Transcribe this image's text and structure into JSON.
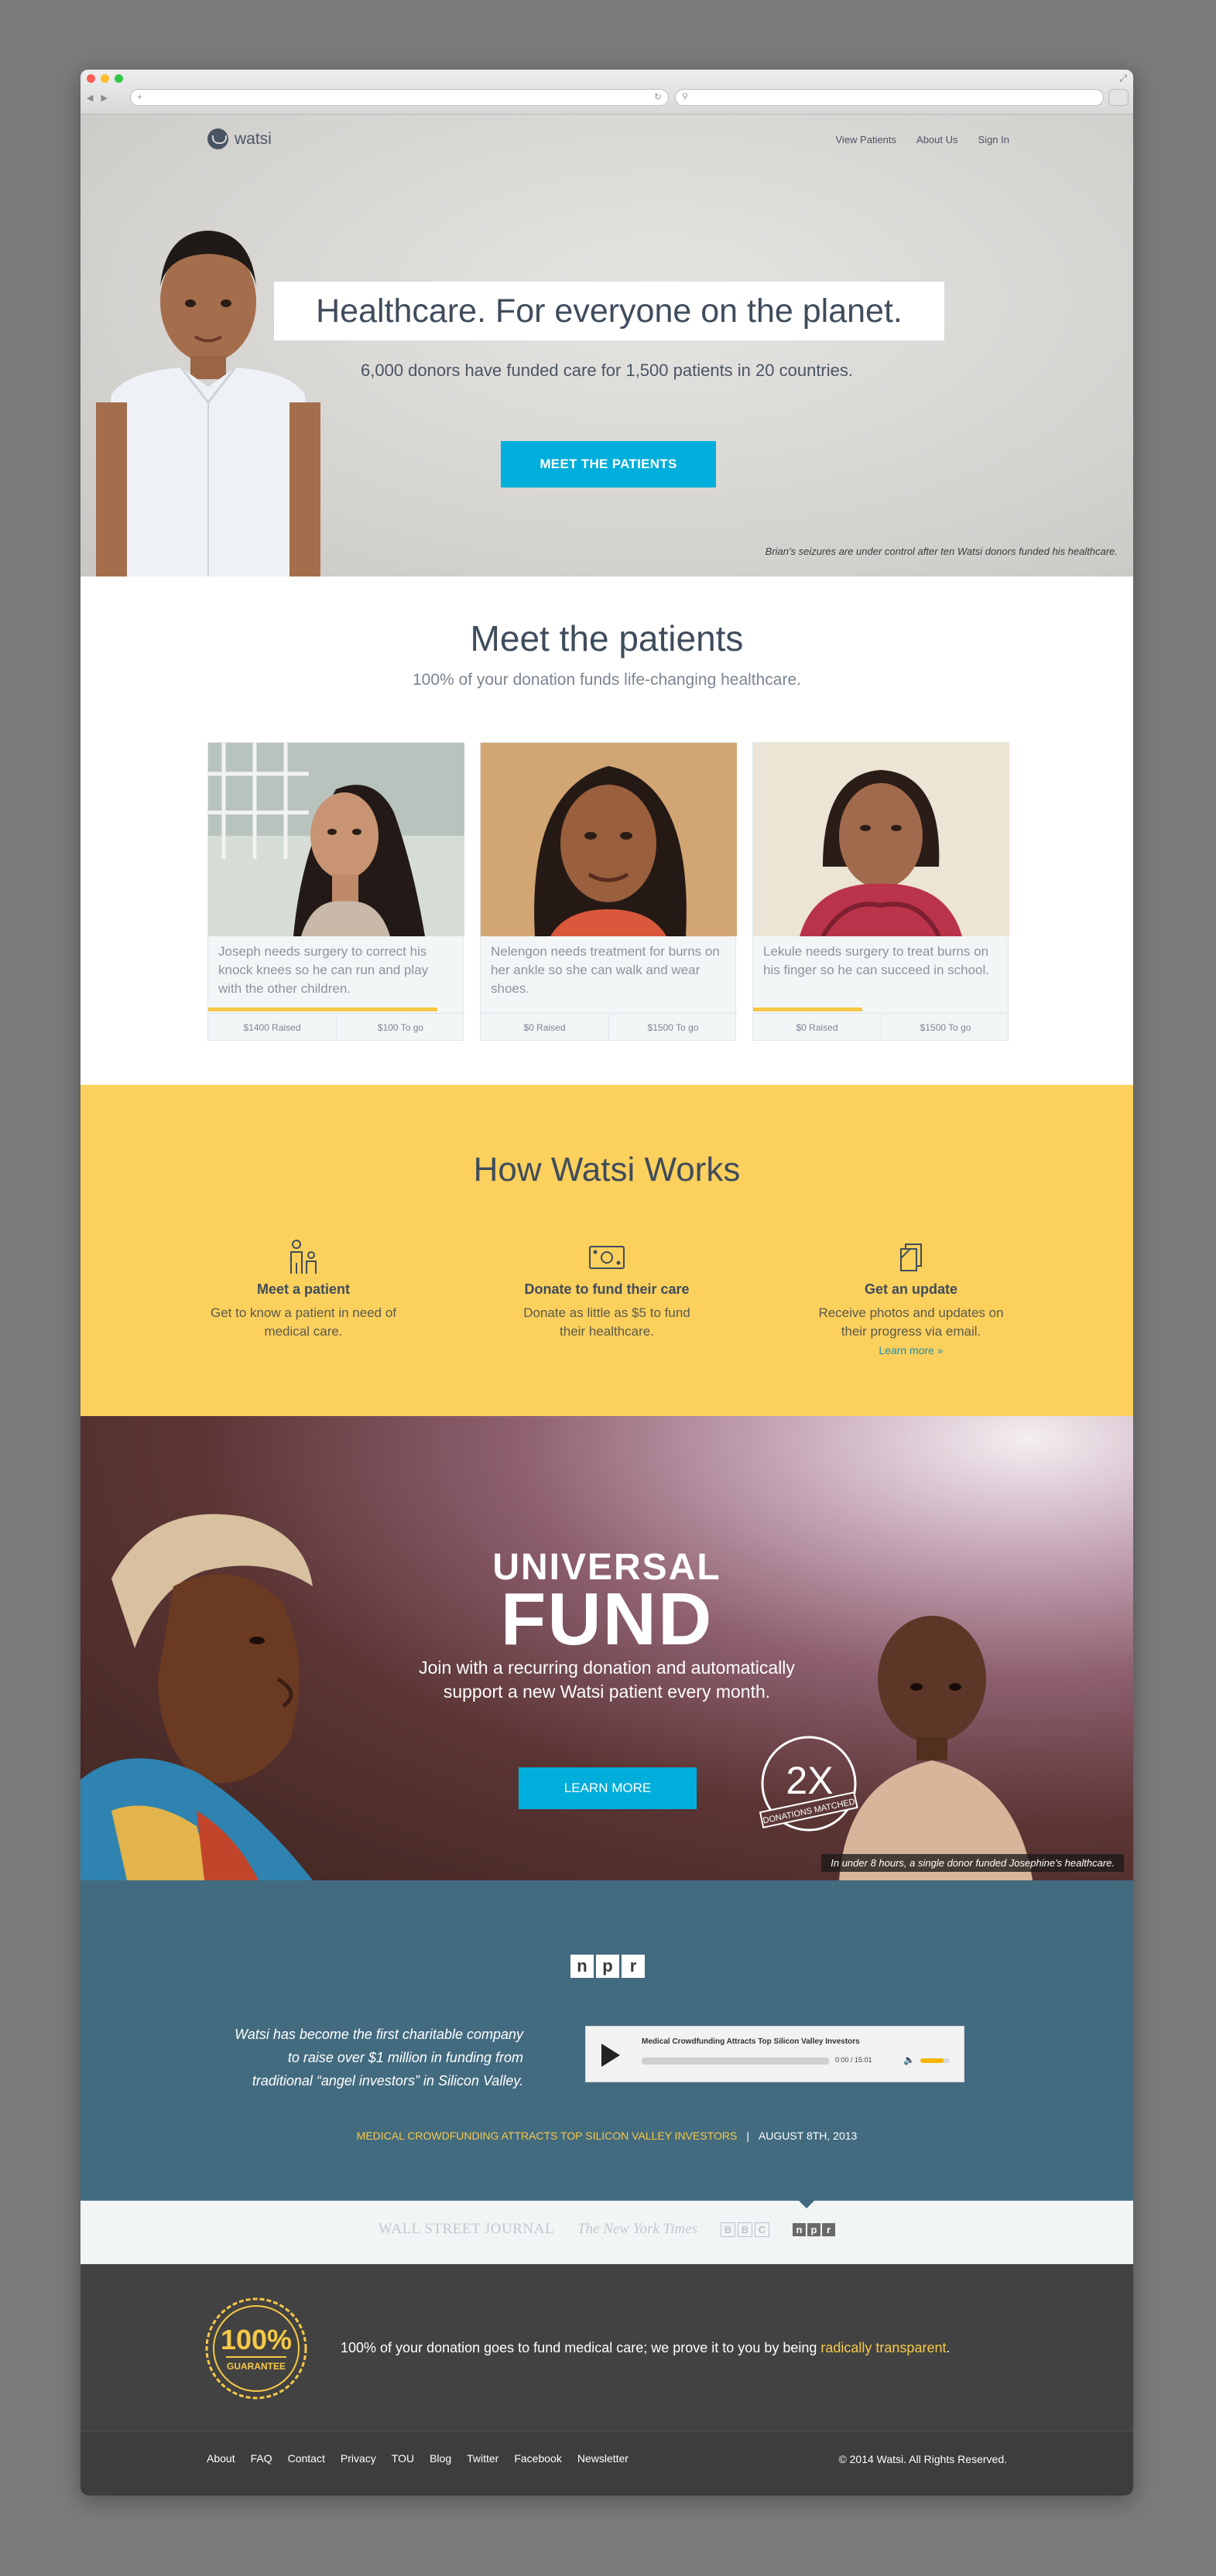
{
  "brand": {
    "logo_text": "watsi"
  },
  "nav": {
    "items": [
      "View Patients",
      "About Us",
      "Sign In"
    ]
  },
  "hero": {
    "title": "Healthcare. For everyone on the planet.",
    "subtitle": "6,000 donors have funded care for 1,500 patients in 20 countries.",
    "cta": "MEET THE PATIENTS",
    "caption": "Brian's seizures are under control after ten Watsi donors funded his healthcare."
  },
  "meet": {
    "title": "Meet the patients",
    "subtitle": "100% of your donation funds life-changing healthcare.",
    "patients": [
      {
        "description": "Joseph needs surgery to correct his knock knees so he can run and play with the other children.",
        "raised": "$1400 Raised",
        "to_go": "$100 To go",
        "progress": 0.9
      },
      {
        "description": "Nelengon needs treatment for burns on her ankle so she can walk and wear shoes.",
        "raised": "$0 Raised",
        "to_go": "$1500 To go",
        "progress": 0
      },
      {
        "description": "Lekule needs surgery to treat burns on his finger so he can succeed in school.",
        "raised": "$0 Raised",
        "to_go": "$1500 To go",
        "progress": 0.43
      }
    ]
  },
  "how": {
    "title": "How Watsi Works",
    "steps": [
      {
        "icon": "people-icon",
        "title": "Meet a patient",
        "text": "Get to know a patient in need of medical care."
      },
      {
        "icon": "money-icon",
        "title": "Donate to fund their care",
        "text": "Donate as little as $5 to fund their healthcare."
      },
      {
        "icon": "document-icon",
        "title": "Get an update",
        "text": "Receive photos and updates on their progress via email.",
        "link": "Learn more »"
      }
    ]
  },
  "fund": {
    "title_line1": "UNIVERSAL",
    "title_line2": "FUND",
    "subtitle": "Join with a recurring donation and automatically support a new Watsi patient every month.",
    "cta": "LEARN MORE",
    "badge_big": "2X",
    "badge_small": "DONATIONS MATCHED",
    "caption": "In under 8 hours, a single donor funded Josephine's healthcare."
  },
  "press": {
    "outlet_letters": [
      "n",
      "p",
      "r"
    ],
    "quote": "Watsi has become the first charitable company to raise over $1 million in funding from traditional “angel investors” in Silicon Valley.",
    "player": {
      "title": "Medical Crowdfunding Attracts Top Silicon Valley Investors",
      "time": "0:00 / 15:01",
      "volume": 0.8
    },
    "headline": "MEDICAL CROWDFUNDING ATTRACTS TOP SILICON VALLEY INVESTORS",
    "date": "AUGUST 8TH, 2013",
    "separator": "|"
  },
  "logos": {
    "wsj": "WALL STREET JOURNAL",
    "nyt": "The New York Times",
    "bbc": [
      "B",
      "B",
      "C"
    ],
    "npr": [
      "n",
      "p",
      "r"
    ]
  },
  "guarantee": {
    "seal_top": "100%",
    "seal_bottom": "GUARANTEE",
    "text": "100% of your donation goes to fund medical care; we prove it to you by being ",
    "highlight": "radically transparent",
    "end": "."
  },
  "footer": {
    "links": [
      "About",
      "FAQ",
      "Contact",
      "Privacy",
      "TOU",
      "Blog",
      "Twitter",
      "Facebook",
      "Newsletter"
    ],
    "copyright": "© 2014 Watsi. All Rights Reserved."
  },
  "colors": {
    "accent": "#00aedb",
    "yellow": "#fcd05c",
    "press_blue": "#436b7f",
    "dark": "#424242",
    "text": "#3f4c5c"
  }
}
